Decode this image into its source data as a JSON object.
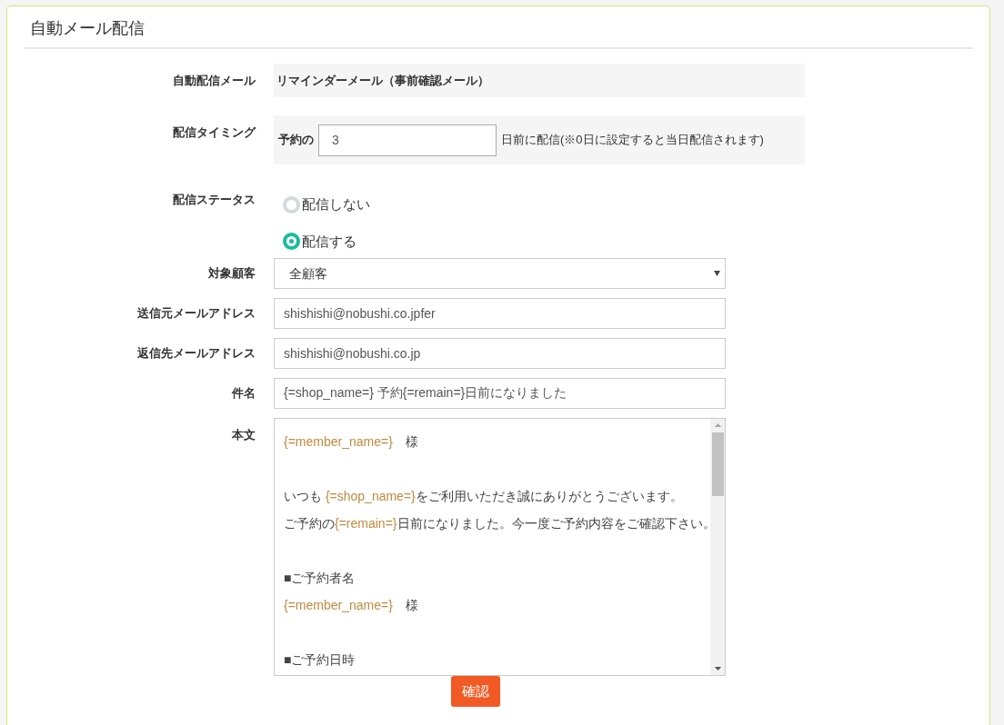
{
  "panel": {
    "title": "自動メール配信"
  },
  "mail_type": {
    "label": "自動配信メール",
    "value": "リマインダーメール（事前確認メール）"
  },
  "timing": {
    "label": "配信タイミング",
    "prefix": "予約の",
    "value": "3",
    "suffix": "日前に配信(※0日に設定すると当日配信されます)"
  },
  "status": {
    "label": "配信ステータス",
    "options": [
      {
        "label": "配信しない",
        "selected": false
      },
      {
        "label": "配信する",
        "selected": true
      }
    ]
  },
  "target": {
    "label": "対象顧客",
    "value": "全顧客"
  },
  "fields": [
    {
      "label": "送信元メールアドレス",
      "value": "shishishi@nobushi.co.jpfer"
    },
    {
      "label": "返信先メールアドレス",
      "value": "shishishi@nobushi.co.jp"
    },
    {
      "label": "件名",
      "value": "{=shop_name=} 予約{=remain=}日前になりました"
    }
  ],
  "body": {
    "label": "本文",
    "lines": [
      {
        "kind": "text",
        "segments": [
          {
            "kind": "tag",
            "text": "{=member_name=}"
          },
          {
            "kind": "plain",
            "text": "　様"
          }
        ]
      },
      {
        "kind": "blank"
      },
      {
        "kind": "text",
        "segments": [
          {
            "kind": "plain",
            "text": "いつも "
          },
          {
            "kind": "tag",
            "text": "{=shop_name=}"
          },
          {
            "kind": "plain",
            "text": "をご利用いただき誠にありがとうございます。"
          }
        ]
      },
      {
        "kind": "text",
        "segments": [
          {
            "kind": "plain",
            "text": "ご予約の"
          },
          {
            "kind": "tag",
            "text": "{=remain=}"
          },
          {
            "kind": "plain",
            "text": "日前になりました。今一度ご予約内容をご確認下さい。"
          }
        ]
      },
      {
        "kind": "blank"
      },
      {
        "kind": "text",
        "segments": [
          {
            "kind": "plain",
            "text": "■ご予約者名"
          }
        ]
      },
      {
        "kind": "text",
        "segments": [
          {
            "kind": "tag",
            "text": "{=member_name=}"
          },
          {
            "kind": "plain",
            "text": "　様"
          }
        ]
      },
      {
        "kind": "blank"
      },
      {
        "kind": "text",
        "segments": [
          {
            "kind": "plain",
            "text": "■ご予約日時"
          }
        ]
      }
    ]
  },
  "confirm_button": "確認"
}
